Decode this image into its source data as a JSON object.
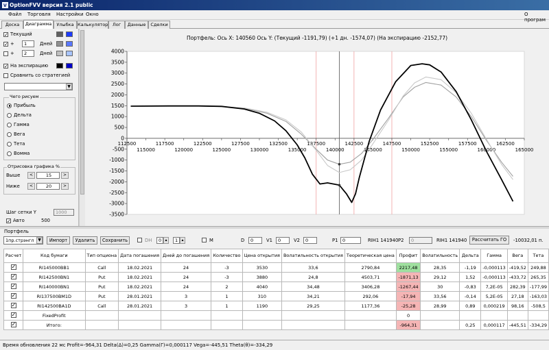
{
  "window": {
    "title": "OptionFVV версия 2.1 public",
    "icon": "app-icon"
  },
  "menu": {
    "items": [
      "Файл",
      "Торговля",
      "Настройки",
      "Окно"
    ],
    "right": "О програм"
  },
  "tabs": [
    "Доска",
    "Диаграмма",
    "Улыбка",
    "Калькулятор",
    "Лог",
    "Данные",
    "Сделки"
  ],
  "left": {
    "current": "Текущий",
    "plus1_val": "1",
    "plus2_val": "2",
    "days": "Дней",
    "expiry": "На экспирацию",
    "compare": "Сравнить со стратегией",
    "draw_title": "Чего рисуем",
    "draw_opts": [
      "Прибыль",
      "Дельта",
      "Гамма",
      "Вега",
      "Тета",
      "Вомма"
    ],
    "render_title": "Отрисовка графика %",
    "above": "Выше",
    "above_val": "15",
    "below": "Ниже",
    "below_val": "20",
    "grid_step": "Шаг сетки Y",
    "grid_val": "1000",
    "auto": "Авто",
    "auto_val": "500"
  },
  "chart_data": {
    "type": "line",
    "title": "Портфель: Ось X: 140560 Ось Y: (Текущий -1191,79) (+1 дн. -1574,07) (На экспирацию -2152,77)",
    "xlim": [
      112500,
      165000
    ],
    "ylim": [
      -3500,
      4000
    ],
    "yticks": [
      4000,
      3500,
      3000,
      2500,
      2000,
      1500,
      1000,
      500,
      0,
      -500,
      -1000,
      -1500,
      -2000,
      -2500,
      -3000,
      -3500
    ],
    "xticks_top": [
      112500,
      117500,
      122500,
      127500,
      132500,
      137500,
      142500,
      147500,
      152500,
      157500,
      162500
    ],
    "xticks_bottom": [
      115000,
      120000,
      125000,
      130000,
      135000,
      140000,
      145000,
      150000,
      155000,
      160000,
      165000
    ],
    "cursor_x": 140560,
    "ref_lines_x": [
      137500,
      142500,
      147500
    ],
    "series": [
      {
        "name": "Текущий",
        "color": "#a0a0a0",
        "x": [
          113000,
          118000,
          122000,
          125000,
          128000,
          131000,
          133500,
          135500,
          137500,
          139000,
          140560,
          142000,
          143500,
          145000,
          147000,
          149000,
          150500,
          152000,
          154000,
          156000,
          158000,
          160000,
          162000,
          163500
        ],
        "y": [
          1480,
          1480,
          1480,
          1460,
          1380,
          1150,
          780,
          200,
          -500,
          -1000,
          -1192,
          -1100,
          -700,
          -50,
          900,
          1900,
          2350,
          2570,
          2450,
          1900,
          1000,
          -100,
          -1100,
          -1750
        ]
      },
      {
        "name": "+1 дн.",
        "color": "#c8c8c8",
        "x": [
          113000,
          118000,
          122000,
          125000,
          128000,
          131000,
          133500,
          135500,
          137500,
          139000,
          140560,
          142000,
          143500,
          145000,
          147000,
          149000,
          150500,
          152000,
          154000,
          156000,
          158000,
          160000,
          162000,
          163500
        ],
        "y": [
          1480,
          1480,
          1480,
          1460,
          1400,
          1200,
          850,
          300,
          -550,
          -1250,
          -1574,
          -1450,
          -1000,
          -250,
          800,
          1950,
          2550,
          2820,
          2700,
          2100,
          1150,
          -50,
          -1200,
          -1900
        ]
      },
      {
        "name": "На экспирацию",
        "color": "#000000",
        "x": [
          113000,
          118000,
          122000,
          125000,
          128000,
          130000,
          132000,
          133500,
          135000,
          136000,
          137000,
          138000,
          139000,
          140560,
          141500,
          142200,
          142700,
          143200,
          144500,
          146000,
          148000,
          150000,
          151500,
          152500,
          154000,
          156000,
          158000,
          160000,
          162000,
          163500
        ],
        "y": [
          1480,
          1490,
          1490,
          1470,
          1350,
          1150,
          800,
          350,
          -300,
          -900,
          -1650,
          -2100,
          -2050,
          -2153,
          -2550,
          -2950,
          -2550,
          -1800,
          -150,
          1300,
          2600,
          3350,
          3430,
          3380,
          3050,
          2150,
          850,
          -600,
          -1900,
          -2900
        ]
      }
    ]
  },
  "portfolio": {
    "label": "Портфель",
    "strategy_select": "1пр.стрэнгл",
    "btn_import": "Импорт",
    "btn_delete": "Удалить",
    "btn_save": "Сохранить",
    "dh": "DH",
    "dh_val1": "0",
    "dh_val2": "1",
    "m": "М",
    "d": "D",
    "d_val": "0",
    "v1": "V1",
    "v1_val": "0",
    "v2": "V2",
    "v2_val": "0",
    "p1": "P1",
    "p1_val": "0",
    "sec1": "RIH1 141940",
    "p2": "P2",
    "p2_val": "0",
    "sec2": "RIH1 141940",
    "btn_calc": "Рассчитать ГО",
    "go_val": "-10032,01 п.",
    "headers": [
      "Расчет",
      "Код бумаги",
      "Тип опциона",
      "Дата погашения",
      "Дней до погашения",
      "Количество",
      "Цена открытия",
      "Волатильность открытия",
      "Теоретическая цена",
      "Профит",
      "Волатильность",
      "Дельта",
      "Гамма",
      "Вега",
      "Тета"
    ],
    "rows": [
      [
        "RI145000BB1",
        "Call",
        "18.02.2021",
        "24",
        "-3",
        "3530",
        "33,6",
        "2790,84",
        "2217,48",
        "28,35",
        "-1,19",
        "-0,000113",
        "-419,52",
        "249,88"
      ],
      [
        "RI142500BN1",
        "Put",
        "18.02.2021",
        "24",
        "-3",
        "3880",
        "24,8",
        "4503,71",
        "-1871,13",
        "29,12",
        "1,52",
        "-0,000113",
        "-433,72",
        "265,35"
      ],
      [
        "RI140000BN1",
        "Put",
        "18.02.2021",
        "24",
        "2",
        "4040",
        "34,48",
        "3406,28",
        "-1267,44",
        "30",
        "-0,83",
        "7,2E-05",
        "282,39",
        "-177,99"
      ],
      [
        "RI137500BM1D",
        "Put",
        "28.01.2021",
        "3",
        "1",
        "310",
        "34,21",
        "292,06",
        "-17,94",
        "33,56",
        "-0,14",
        "5,2E-05",
        "27,18",
        "-163,03"
      ],
      [
        "RI142500BA1D",
        "Call",
        "28.01.2021",
        "3",
        "1",
        "1190",
        "29,25",
        "1177,36",
        "-25,28",
        "28,99",
        "0,89",
        "0,000219",
        "98,16",
        "-508,5"
      ]
    ],
    "fixed_label": "FixedProfit",
    "fixed_val": "0",
    "total_label": "Итого:",
    "total_profit": "-964,31",
    "total_delta": "0,25",
    "total_gamma": "0,000117",
    "total_vega": "-445,51",
    "total_theta": "-334,29"
  },
  "status": "Время обновления 22 мс  Profit=-964,31 Delta(Δ)=0,25 Gamma(Γ)=0,000117 Vega=-445,51 Theta(θ)=-334,29"
}
